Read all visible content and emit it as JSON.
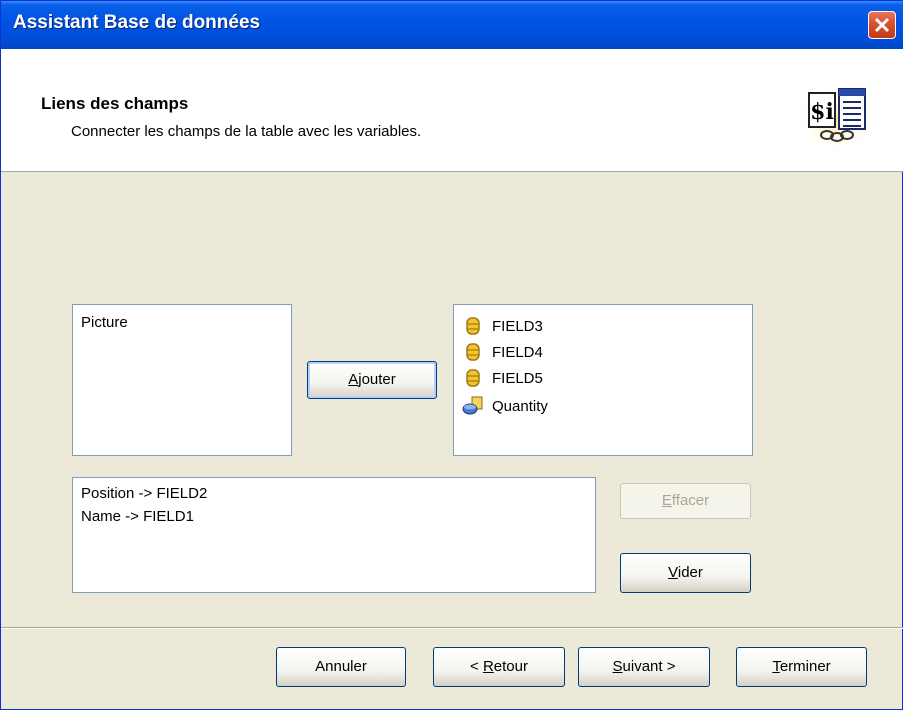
{
  "window": {
    "title": "Assistant Base de données"
  },
  "header": {
    "title": "Liens des champs",
    "subtitle": "Connecter les champs de la table avec les variables."
  },
  "variables_list": {
    "items": [
      "Picture"
    ]
  },
  "add_button": {
    "label_pre": "",
    "label_mnemonic": "A",
    "label_post": "jouter"
  },
  "fields_list": {
    "items": [
      {
        "label": "FIELD3",
        "icon": "database-field-icon"
      },
      {
        "label": "FIELD4",
        "icon": "database-field-icon"
      },
      {
        "label": "FIELD5",
        "icon": "database-field-icon"
      },
      {
        "label": "Quantity",
        "icon": "dataset-icon"
      }
    ]
  },
  "links_list": {
    "items": [
      "Position -> FIELD2",
      "Name -> FIELD1"
    ]
  },
  "clear_button": {
    "label_pre": "",
    "label_mnemonic": "E",
    "label_post": "ffacer"
  },
  "empty_button": {
    "label_pre": "",
    "label_mnemonic": "V",
    "label_post": "ider"
  },
  "footer": {
    "cancel": "Annuler",
    "back_pre": "< ",
    "back_mnemonic": "R",
    "back_post": "etour",
    "next_pre": "",
    "next_mnemonic": "S",
    "next_post": "uivant >",
    "finish_pre": "",
    "finish_mnemonic": "T",
    "finish_post": "erminer"
  },
  "colors": {
    "titlebar": "#0054e3",
    "dialog_bg": "#ece9d8",
    "close": "#d64d2f"
  }
}
